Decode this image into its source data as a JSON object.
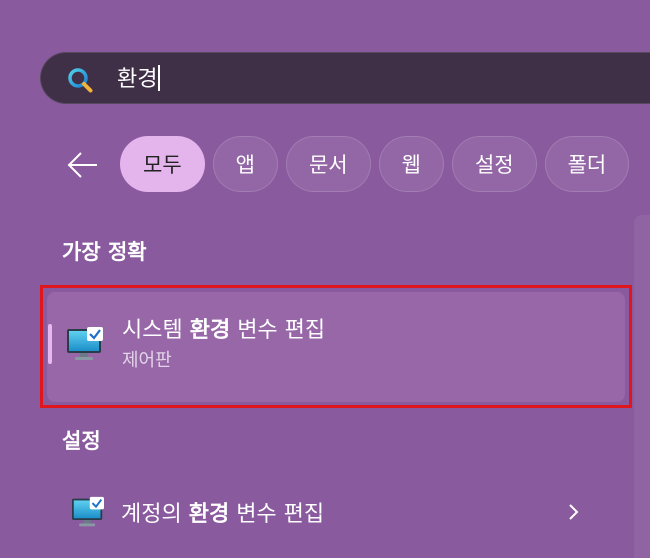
{
  "search": {
    "query": "환경"
  },
  "filters": {
    "tabs": [
      {
        "label": "모두",
        "active": true
      },
      {
        "label": "앱",
        "active": false
      },
      {
        "label": "문서",
        "active": false
      },
      {
        "label": "웹",
        "active": false
      },
      {
        "label": "설정",
        "active": false
      },
      {
        "label": "폴더",
        "active": false
      }
    ]
  },
  "best_match": {
    "heading": "가장 정확",
    "item": {
      "name_prefix": "시스템 ",
      "name_bold": "환경",
      "name_suffix": " 변수 편집",
      "subtitle": "제어판",
      "icon": "monitor-checkmark-icon"
    }
  },
  "settings_section": {
    "heading": "설정",
    "items": [
      {
        "name_prefix": "계정의 ",
        "name_bold": "환경",
        "name_suffix": " 변수 편집",
        "icon": "monitor-checkmark-icon"
      }
    ]
  },
  "colors": {
    "background": "#8a5a9e",
    "search_box": "#3f2f47",
    "active_tab": "#e4b4ec",
    "selection_frame": "#e0161e"
  }
}
